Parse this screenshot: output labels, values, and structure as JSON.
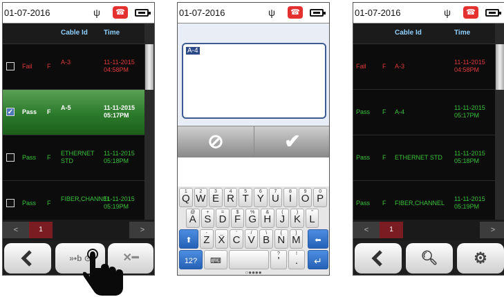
{
  "screens": [
    {
      "status": {
        "date": "01-07-2016",
        "usb_icon": "usb-icon",
        "phone_icon": "hangup-icon",
        "battery_icon": "battery-icon"
      },
      "headers": {
        "cable_id": "Cable Id",
        "time": "Time"
      },
      "rows": [
        {
          "result": "Fail",
          "flag": "F",
          "cable": "A-3",
          "date": "11-11-2015",
          "time": "04:58PM",
          "checked": false
        },
        {
          "result": "Pass",
          "flag": "F",
          "cable": "A-5",
          "date": "11-11-2015",
          "time": "05:17PM",
          "checked": true
        },
        {
          "result": "Pass",
          "flag": "F",
          "cable": "ETHERNET STD",
          "date": "11-11-2015",
          "time": "05:18PM",
          "checked": false
        },
        {
          "result": "Pass",
          "flag": "F",
          "cable": "FIBER,CHANNEL",
          "date": "11-11-2015",
          "time": "05:19PM",
          "checked": false
        }
      ],
      "pager": {
        "prev": "<",
        "page": "1",
        "next": ">"
      },
      "toolbar": {
        "back_icon": "back-arrow-icon",
        "compare_icon": "compare-icon",
        "delete_icon": "delete-icon"
      }
    },
    {
      "status": {
        "date": "01-07-2016"
      },
      "input_value": "A-4",
      "actions": {
        "cancel_icon": "cancel-icon",
        "ok_icon": "checkmark-icon"
      },
      "keyboard": {
        "row1": [
          [
            "Q",
            "1"
          ],
          [
            "W",
            "2"
          ],
          [
            "E",
            "3"
          ],
          [
            "R",
            "4"
          ],
          [
            "T",
            "5"
          ],
          [
            "Y",
            "6"
          ],
          [
            "U",
            "7"
          ],
          [
            "I",
            "8"
          ],
          [
            "O",
            "9"
          ],
          [
            "P",
            "0"
          ]
        ],
        "row2": [
          [
            "A",
            "@"
          ],
          [
            "S",
            "+"
          ],
          [
            "D",
            "="
          ],
          [
            "F",
            "$"
          ],
          [
            "G",
            "%"
          ],
          [
            "H",
            "&"
          ],
          [
            "J",
            "("
          ],
          [
            "K",
            ")"
          ],
          [
            "L",
            "\""
          ]
        ],
        "row3": [
          [
            "Z",
            "-"
          ],
          [
            "X",
            "_"
          ],
          [
            "C",
            "'"
          ],
          [
            "V",
            "/"
          ],
          [
            "B",
            "\\"
          ],
          [
            "N",
            "{"
          ],
          [
            "M",
            "}"
          ]
        ],
        "symbols_key": "12?",
        "punct": [
          [
            "?",
            "'"
          ],
          [
            "!",
            "."
          ]
        ]
      }
    },
    {
      "status": {
        "date": "01-07-2016"
      },
      "headers": {
        "cable_id": "Cable Id",
        "time": "Time"
      },
      "rows": [
        {
          "result": "Fail",
          "flag": "F",
          "cable": "A-3",
          "date": "11-11-2015",
          "time": "04:58PM"
        },
        {
          "result": "Pass",
          "flag": "F",
          "cable": "A-4",
          "date": "11-11-2015",
          "time": "05:17PM"
        },
        {
          "result": "Pass",
          "flag": "F",
          "cable": "ETHERNET STD",
          "date": "11-11-2015",
          "time": "05:18PM"
        },
        {
          "result": "Pass",
          "flag": "F",
          "cable": "FIBER,CHANNEL",
          "date": "11-11-2015",
          "time": "05:19PM"
        }
      ],
      "pager": {
        "prev": "<",
        "page": "1",
        "next": ">"
      },
      "toolbar": {
        "back_icon": "back-arrow-icon",
        "search_icon": "search-icon",
        "settings_icon": "gear-icon"
      }
    }
  ]
}
